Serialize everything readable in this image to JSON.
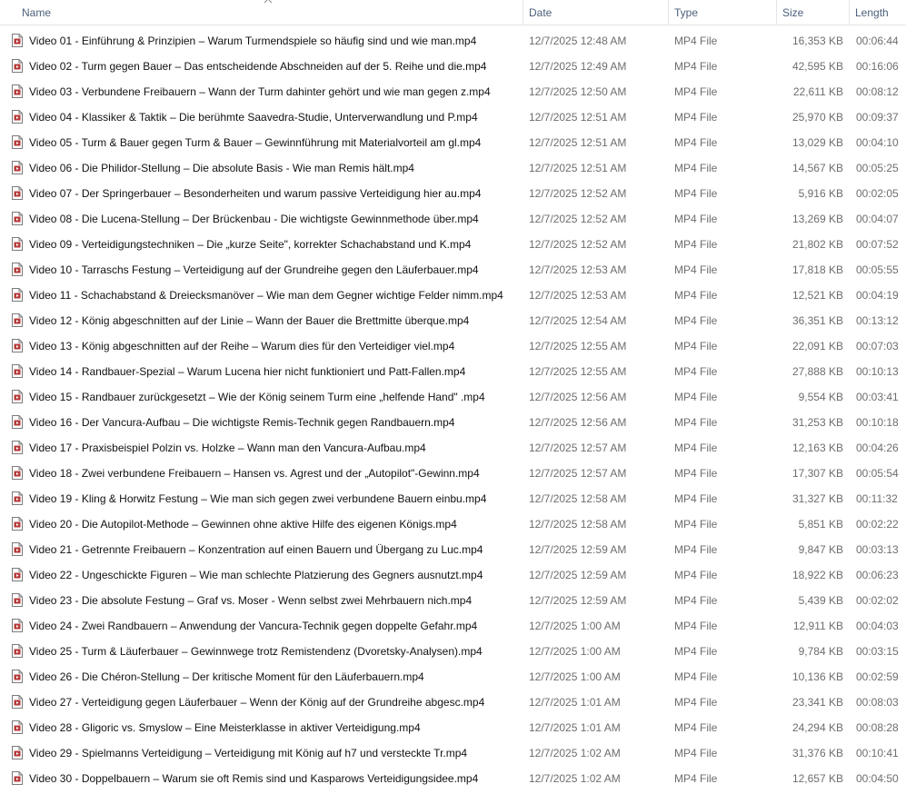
{
  "columns": {
    "name": "Name",
    "date": "Date",
    "type": "Type",
    "size": "Size",
    "length": "Length"
  },
  "sort": {
    "column": "name",
    "direction": "ascending",
    "icon": "sort-up-chevron-icon"
  },
  "icon": "video-file-icon",
  "files": [
    {
      "name": "Video 01 -  Einführung & Prinzipien – Warum Turmendspiele so häufig sind und wie man.mp4",
      "date": "12/7/2025 12:48 AM",
      "type": "MP4 File",
      "size": "16,353 KB",
      "length": "00:06:44"
    },
    {
      "name": "Video 02 -  Turm gegen Bauer – Das entscheidende Abschneiden auf der 5. Reihe und die.mp4",
      "date": "12/7/2025 12:49 AM",
      "type": "MP4 File",
      "size": "42,595 KB",
      "length": "00:16:06"
    },
    {
      "name": "Video 03 -  Verbundene Freibauern – Wann der Turm dahinter gehört und wie man gegen z.mp4",
      "date": "12/7/2025 12:50 AM",
      "type": "MP4 File",
      "size": "22,611 KB",
      "length": "00:08:12"
    },
    {
      "name": "Video 04 -  Klassiker & Taktik – Die berühmte Saavedra-Studie, Unterverwandlung und P.mp4",
      "date": "12/7/2025 12:51 AM",
      "type": "MP4 File",
      "size": "25,970 KB",
      "length": "00:09:37"
    },
    {
      "name": "Video 05 -  Turm & Bauer gegen Turm & Bauer – Gewinnführung mit Materialvorteil am gl.mp4",
      "date": "12/7/2025 12:51 AM",
      "type": "MP4 File",
      "size": "13,029 KB",
      "length": "00:04:10"
    },
    {
      "name": "Video 06 -  Die Philidor-Stellung – Die absolute Basis -  Wie man Remis hält.mp4",
      "date": "12/7/2025 12:51 AM",
      "type": "MP4 File",
      "size": "14,567 KB",
      "length": "00:05:25"
    },
    {
      "name": "Video 07 -  Der Springerbauer – Besonderheiten und warum passive Verteidigung hier au.mp4",
      "date": "12/7/2025 12:52 AM",
      "type": "MP4 File",
      "size": "5,916 KB",
      "length": "00:02:05"
    },
    {
      "name": "Video 08 -  Die Lucena-Stellung – Der Brückenbau -  Die wichtigste Gewinnmethode über.mp4",
      "date": "12/7/2025 12:52 AM",
      "type": "MP4 File",
      "size": "13,269 KB",
      "length": "00:04:07"
    },
    {
      "name": "Video 09 -  Verteidigungstechniken – Die „kurze Seite\", korrekter Schachabstand und K.mp4",
      "date": "12/7/2025 12:52 AM",
      "type": "MP4 File",
      "size": "21,802 KB",
      "length": "00:07:52"
    },
    {
      "name": "Video 10 -  Tarraschs Festung – Verteidigung auf der Grundreihe gegen den Läuferbauer.mp4",
      "date": "12/7/2025 12:53 AM",
      "type": "MP4 File",
      "size": "17,818 KB",
      "length": "00:05:55"
    },
    {
      "name": "Video 11 -  Schachabstand & Dreiecksmanöver – Wie man dem Gegner wichtige Felder nimm.mp4",
      "date": "12/7/2025 12:53 AM",
      "type": "MP4 File",
      "size": "12,521 KB",
      "length": "00:04:19"
    },
    {
      "name": "Video 12 -  König abgeschnitten auf der Linie – Wann der Bauer die Brettmitte überque.mp4",
      "date": "12/7/2025 12:54 AM",
      "type": "MP4 File",
      "size": "36,351 KB",
      "length": "00:13:12"
    },
    {
      "name": "Video 13 -  König abgeschnitten auf der Reihe – Warum dies für den Verteidiger viel.mp4",
      "date": "12/7/2025 12:55 AM",
      "type": "MP4 File",
      "size": "22,091 KB",
      "length": "00:07:03"
    },
    {
      "name": "Video 14 -  Randbauer-Spezial – Warum Lucena hier nicht funktioniert und Patt-Fallen.mp4",
      "date": "12/7/2025 12:55 AM",
      "type": "MP4 File",
      "size": "27,888 KB",
      "length": "00:10:13"
    },
    {
      "name": "Video 15 -  Randbauer zurückgesetzt – Wie der König seinem Turm eine „helfende Hand\" .mp4",
      "date": "12/7/2025 12:56 AM",
      "type": "MP4 File",
      "size": "9,554 KB",
      "length": "00:03:41"
    },
    {
      "name": "Video 16 -  Der Vancura-Aufbau – Die wichtigste Remis-Technik gegen Randbauern.mp4",
      "date": "12/7/2025 12:56 AM",
      "type": "MP4 File",
      "size": "31,253 KB",
      "length": "00:10:18"
    },
    {
      "name": "Video 17 -  Praxisbeispiel Polzin vs. Holzke – Wann man den Vancura-Aufbau.mp4",
      "date": "12/7/2025 12:57 AM",
      "type": "MP4 File",
      "size": "12,163 KB",
      "length": "00:04:26"
    },
    {
      "name": "Video 18 -  Zwei verbundene Freibauern – Hansen vs. Agrest und der „Autopilot\"-Gewinn.mp4",
      "date": "12/7/2025 12:57 AM",
      "type": "MP4 File",
      "size": "17,307 KB",
      "length": "00:05:54"
    },
    {
      "name": "Video 19 -  Kling & Horwitz Festung – Wie man sich gegen zwei verbundene Bauern einbu.mp4",
      "date": "12/7/2025 12:58 AM",
      "type": "MP4 File",
      "size": "31,327 KB",
      "length": "00:11:32"
    },
    {
      "name": "Video 20 -  Die Autopilot-Methode – Gewinnen ohne aktive Hilfe des eigenen Königs.mp4",
      "date": "12/7/2025 12:58 AM",
      "type": "MP4 File",
      "size": "5,851 KB",
      "length": "00:02:22"
    },
    {
      "name": "Video 21 -  Getrennte Freibauern – Konzentration auf einen Bauern und Übergang zu Luc.mp4",
      "date": "12/7/2025 12:59 AM",
      "type": "MP4 File",
      "size": "9,847 KB",
      "length": "00:03:13"
    },
    {
      "name": "Video 22 -  Ungeschickte Figuren – Wie man schlechte Platzierung des Gegners ausnutzt.mp4",
      "date": "12/7/2025 12:59 AM",
      "type": "MP4 File",
      "size": "18,922 KB",
      "length": "00:06:23"
    },
    {
      "name": "Video 23 -  Die absolute Festung – Graf vs. Moser -  Wenn selbst zwei Mehrbauern nich.mp4",
      "date": "12/7/2025 12:59 AM",
      "type": "MP4 File",
      "size": "5,439 KB",
      "length": "00:02:02"
    },
    {
      "name": "Video 24 -  Zwei Randbauern – Anwendung der Vancura-Technik gegen doppelte Gefahr.mp4",
      "date": "12/7/2025 1:00 AM",
      "type": "MP4 File",
      "size": "12,911 KB",
      "length": "00:04:03"
    },
    {
      "name": "Video 25 -  Turm & Läuferbauer – Gewinnwege trotz Remistendenz (Dvoretsky-Analysen).mp4",
      "date": "12/7/2025 1:00 AM",
      "type": "MP4 File",
      "size": "9,784 KB",
      "length": "00:03:15"
    },
    {
      "name": "Video 26 -  Die Chéron-Stellung – Der kritische Moment für den Läuferbauern.mp4",
      "date": "12/7/2025 1:00 AM",
      "type": "MP4 File",
      "size": "10,136 KB",
      "length": "00:02:59"
    },
    {
      "name": "Video 27 -  Verteidigung gegen Läuferbauer – Wenn der König auf der Grundreihe abgesc.mp4",
      "date": "12/7/2025 1:01 AM",
      "type": "MP4 File",
      "size": "23,341 KB",
      "length": "00:08:03"
    },
    {
      "name": "Video 28 -  Gligoric vs. Smyslow – Eine Meisterklasse in aktiver Verteidigung.mp4",
      "date": "12/7/2025 1:01 AM",
      "type": "MP4 File",
      "size": "24,294 KB",
      "length": "00:08:28"
    },
    {
      "name": "Video 29 -  Spielmanns Verteidigung – Verteidigung mit König auf h7 und versteckte Tr.mp4",
      "date": "12/7/2025 1:02 AM",
      "type": "MP4 File",
      "size": "31,376 KB",
      "length": "00:10:41"
    },
    {
      "name": "Video 30 -  Doppelbauern – Warum sie oft Remis sind und Kasparows Verteidigungsidee.mp4",
      "date": "12/7/2025 1:02 AM",
      "type": "MP4 File",
      "size": "12,657 KB",
      "length": "00:04:50"
    }
  ]
}
